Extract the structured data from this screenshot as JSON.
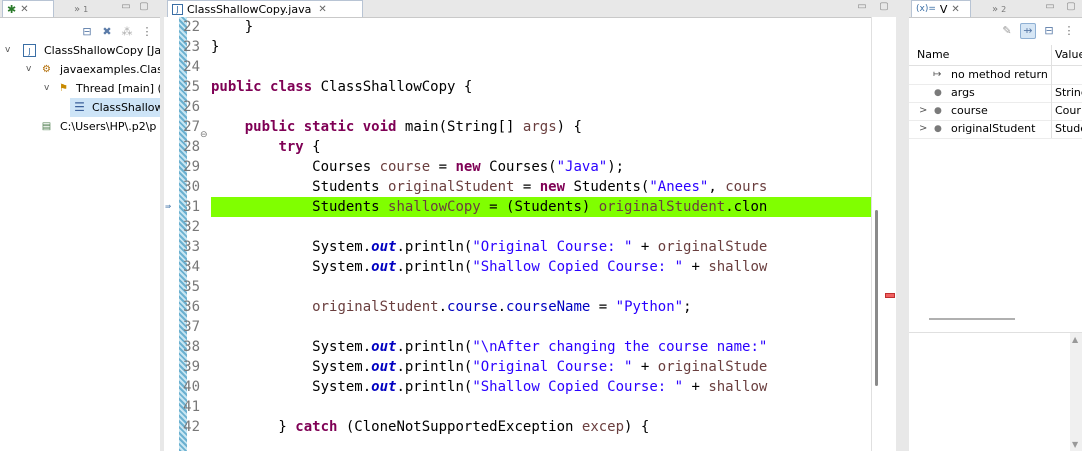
{
  "left_view": {
    "tab_num": "1",
    "tree": [
      {
        "label": "ClassShallowCopy [Ja",
        "icon": "java-app-icon",
        "twisty": "v"
      },
      {
        "label": "javaexamples.Class",
        "icon": "debug-target-icon",
        "twisty": "v"
      },
      {
        "label": "Thread [main] (",
        "icon": "thread-icon",
        "twisty": "v"
      },
      {
        "label": "ClassShallow",
        "icon": "stack-frame-icon",
        "twisty": ""
      },
      {
        "label": "C:\\Users\\HP\\.p2\\p",
        "icon": "process-icon",
        "twisty": ""
      }
    ]
  },
  "editor": {
    "tab_title": "ClassShallowCopy.java",
    "line_numbers": [
      "22",
      "23",
      "24",
      "25",
      "26",
      "27",
      "28",
      "29",
      "30",
      "31",
      "32",
      "33",
      "34",
      "35",
      "36",
      "37",
      "38",
      "39",
      "40",
      "41",
      "42"
    ],
    "current_line": "31"
  },
  "variables_view": {
    "tab_title": "V",
    "tab_num": "2",
    "col_name": "Name",
    "col_value": "Value",
    "rows": [
      {
        "name": "no method return",
        "value": "",
        "icon": "return-icon",
        "twisty": ""
      },
      {
        "name": "args",
        "value": "String",
        "icon": "local-var-icon",
        "twisty": ""
      },
      {
        "name": "course",
        "value": "Cour",
        "icon": "local-var-icon",
        "twisty": ">"
      },
      {
        "name": "originalStudent",
        "value": "Stude",
        "icon": "local-var-icon",
        "twisty": ">"
      }
    ]
  }
}
